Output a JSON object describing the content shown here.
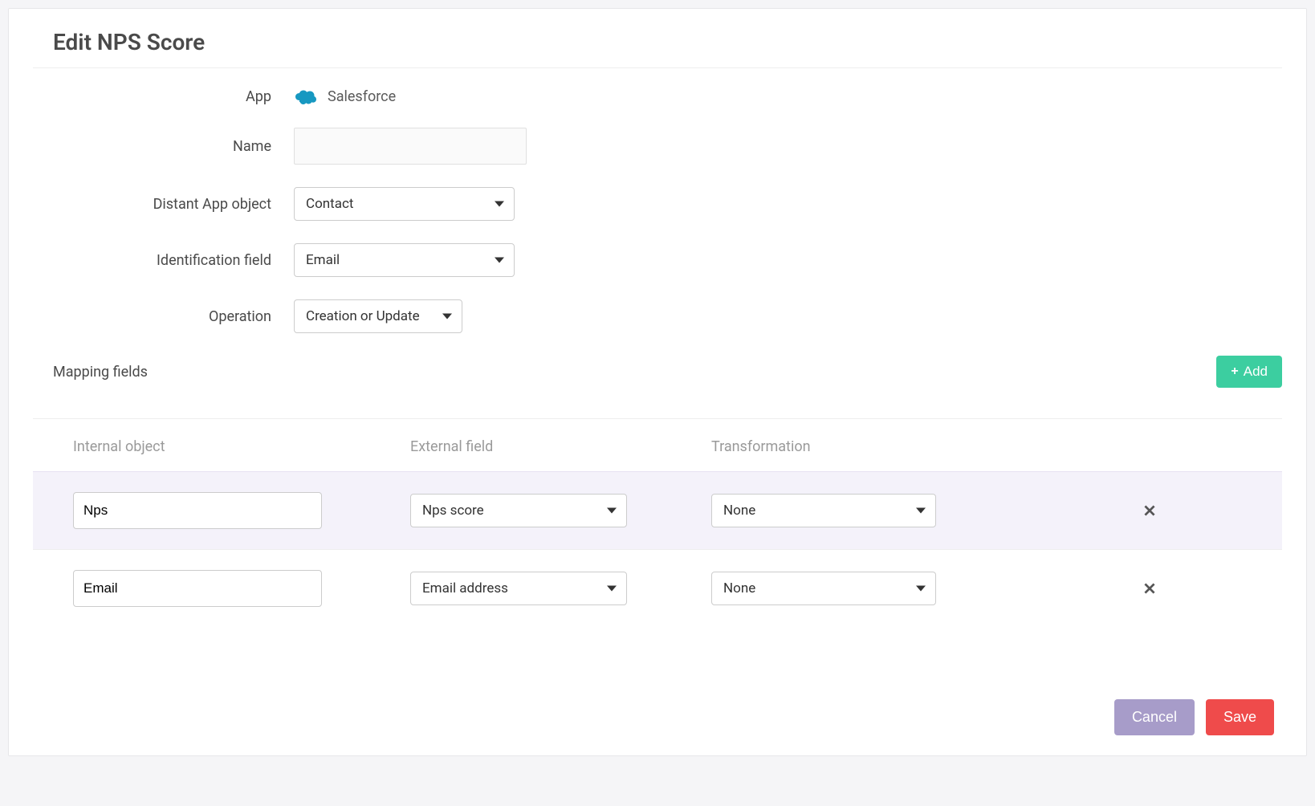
{
  "page_title": "Edit NPS Score",
  "form": {
    "app_label": "App",
    "app_value": "Salesforce",
    "name_label": "Name",
    "name_value": "",
    "distant_object_label": "Distant App object",
    "distant_object_value": "Contact",
    "identification_label": "Identification field",
    "identification_value": "Email",
    "operation_label": "Operation",
    "operation_value": "Creation or Update"
  },
  "mapping": {
    "section_title": "Mapping fields",
    "add_label": "Add",
    "columns": {
      "internal": "Internal object",
      "external": "External field",
      "transformation": "Transformation"
    },
    "rows": [
      {
        "internal": "Nps",
        "external": "Nps score",
        "transformation": "None"
      },
      {
        "internal": "Email",
        "external": "Email address",
        "transformation": "None"
      }
    ]
  },
  "actions": {
    "cancel": "Cancel",
    "save": "Save"
  }
}
